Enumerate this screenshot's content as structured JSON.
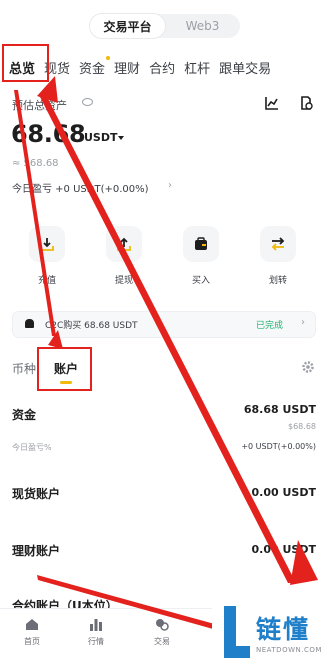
{
  "platform_toggle": {
    "active": "交易平台",
    "inactive": "Web3"
  },
  "top_tabs": [
    {
      "label": "总览",
      "active": true
    },
    {
      "label": "现货",
      "active": false
    },
    {
      "label": "资金",
      "active": false,
      "dot": true
    },
    {
      "label": "理财",
      "active": false
    },
    {
      "label": "合约",
      "active": false
    },
    {
      "label": "杠杆",
      "active": false
    },
    {
      "label": "跟单交易",
      "active": false
    }
  ],
  "overview": {
    "est_label": "预估总资产",
    "balance": "68.68",
    "unit": "USDT",
    "approx": "≈ $68.68",
    "pnl": "今日盈亏 +0 USDT(+0.00%)"
  },
  "actions": [
    {
      "label": "充值",
      "icon": "deposit-icon"
    },
    {
      "label": "提现",
      "icon": "withdraw-icon"
    },
    {
      "label": "买入",
      "icon": "wallet-icon"
    },
    {
      "label": "划转",
      "icon": "transfer-icon"
    }
  ],
  "notice": {
    "text": "C2C购买 68.68 USDT",
    "status": "已完成"
  },
  "sub_tabs": [
    {
      "label": "币种",
      "active": false
    },
    {
      "label": "账户",
      "active": true
    }
  ],
  "accounts": {
    "funds": {
      "label": "资金",
      "value": "68.68 USDT",
      "approx": "$68.68",
      "note": "今日盈亏%",
      "pnl": "+0 USDT(+0.00%)"
    },
    "spot": {
      "label": "现货账户",
      "value": "0.00 USDT"
    },
    "earn": {
      "label": "理财账户",
      "value": "0.00 USDT"
    },
    "futures": {
      "label": "合约账户（U本位）"
    }
  },
  "bottom_nav": [
    {
      "label": "首页",
      "icon": "home-icon"
    },
    {
      "label": "行情",
      "icon": "market-icon"
    },
    {
      "label": "交易",
      "icon": "trade-icon"
    }
  ],
  "watermark": {
    "brand": "链懂",
    "domain": "NEATDOWN.COM"
  },
  "colors": {
    "accent": "#f0b90b",
    "success": "#20b26c",
    "annotation": "#e3221e"
  }
}
